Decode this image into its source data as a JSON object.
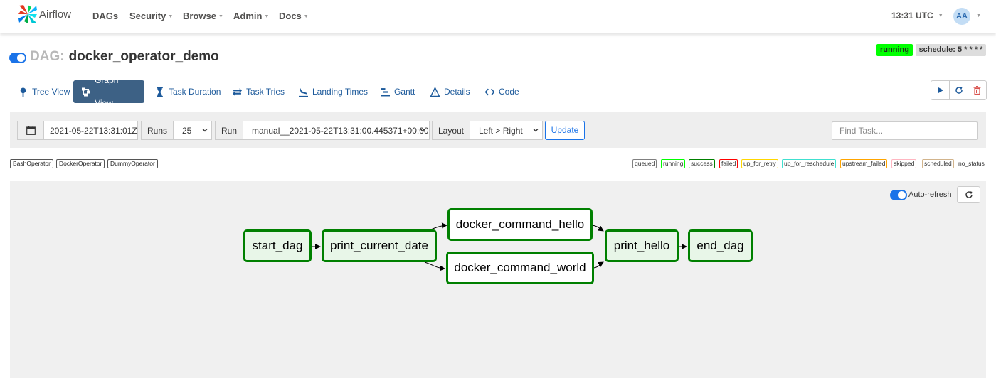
{
  "navbar": {
    "brand": "Airflow",
    "items": [
      {
        "label": "DAGs",
        "dropdown": false
      },
      {
        "label": "Security",
        "dropdown": true
      },
      {
        "label": "Browse",
        "dropdown": true
      },
      {
        "label": "Admin",
        "dropdown": true
      },
      {
        "label": "Docs",
        "dropdown": true
      }
    ],
    "time": "13:31 UTC",
    "avatar": "AA"
  },
  "dag": {
    "prefix": "DAG:",
    "name": "docker_operator_demo",
    "status": "running",
    "schedule": "schedule: 5 * * * *",
    "paused_toggle_on": true
  },
  "tabs": [
    {
      "label": "Tree View",
      "icon": "tree-icon",
      "active": false
    },
    {
      "label": "Graph View",
      "icon": "graph-icon",
      "active": true
    },
    {
      "label": "Task Duration",
      "icon": "hourglass-icon",
      "active": false
    },
    {
      "label": "Task Tries",
      "icon": "retry-icon",
      "active": false
    },
    {
      "label": "Landing Times",
      "icon": "landing-icon",
      "active": false
    },
    {
      "label": "Gantt",
      "icon": "gantt-icon",
      "active": false
    },
    {
      "label": "Details",
      "icon": "warning-triangle-icon",
      "active": false
    },
    {
      "label": "Code",
      "icon": "code-icon",
      "active": false
    }
  ],
  "actions": [
    "play-icon",
    "refresh-icon",
    "trash-icon"
  ],
  "filters": {
    "base_date": "2021-05-22T13:31:01Z",
    "runs_label": "Runs",
    "runs_value": "25",
    "run_label": "Run",
    "run_value": "manual__2021-05-22T13:31:00.445371+00:00",
    "layout_label": "Layout",
    "layout_value": "Left > Right",
    "update": "Update",
    "find_task_placeholder": "Find Task..."
  },
  "operators": [
    "BashOperator",
    "DockerOperator",
    "DummyOperator"
  ],
  "states": [
    {
      "label": "queued",
      "color": "#808080"
    },
    {
      "label": "running",
      "color": "#00ff00"
    },
    {
      "label": "success",
      "color": "#008000"
    },
    {
      "label": "failed",
      "color": "#ff0000"
    },
    {
      "label": "up_for_retry",
      "color": "#ffd700"
    },
    {
      "label": "up_for_reschedule",
      "color": "#40e0d0"
    },
    {
      "label": "upstream_failed",
      "color": "#ffa500"
    },
    {
      "label": "skipped",
      "color": "#ffb6c1"
    },
    {
      "label": "scheduled",
      "color": "#d2b48c"
    },
    {
      "label": "no_status",
      "color": "#ffffff"
    }
  ],
  "graph": {
    "auto_refresh": "Auto-refresh",
    "auto_refresh_on": true,
    "nodes": [
      {
        "id": "start_dag",
        "label": "start_dag",
        "state": "success"
      },
      {
        "id": "print_current_date",
        "label": "print_current_date",
        "state": "success"
      },
      {
        "id": "docker_command_hello",
        "label": "docker_command_hello",
        "state": "success"
      },
      {
        "id": "docker_command_world",
        "label": "docker_command_world",
        "state": "success"
      },
      {
        "id": "print_hello",
        "label": "print_hello",
        "state": "success"
      },
      {
        "id": "end_dag",
        "label": "end_dag",
        "state": "success"
      }
    ],
    "edges": [
      [
        "start_dag",
        "print_current_date"
      ],
      [
        "print_current_date",
        "docker_command_hello"
      ],
      [
        "print_current_date",
        "docker_command_world"
      ],
      [
        "docker_command_hello",
        "print_hello"
      ],
      [
        "docker_command_world",
        "print_hello"
      ],
      [
        "print_hello",
        "end_dag"
      ]
    ]
  }
}
